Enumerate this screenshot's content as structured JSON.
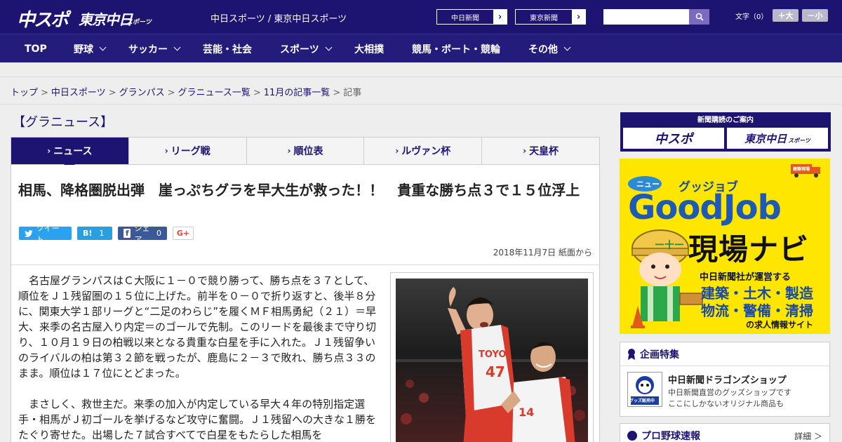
{
  "header": {
    "logo_chunichi": "中スポ",
    "logo_tokyo": "東京中日",
    "logo_tokyo_sub": "スポーツ",
    "site_links": "中日スポーツ / 東京中日スポーツ",
    "newspaper_btn_1": "中日新聞",
    "newspaper_btn_2": "東京新聞",
    "search_placeholder": "",
    "fontsize_label": "文字（0）",
    "fontsize_up": "＋大",
    "fontsize_down": "－小"
  },
  "nav": {
    "items": [
      {
        "label": "TOP"
      },
      {
        "label": "野球"
      },
      {
        "label": "サッカー"
      },
      {
        "label": "芸能・社会"
      },
      {
        "label": "スポーツ"
      },
      {
        "label": "大相撲"
      },
      {
        "label": "競馬・ボート・競輪"
      },
      {
        "label": "その他"
      }
    ]
  },
  "breadcrumb": {
    "items": [
      "トップ",
      "中日スポーツ",
      "グランパス",
      "グラニュース一覧",
      "11月の記事一覧"
    ],
    "current": "記事",
    "separator": ">"
  },
  "section_title": "【グラニュース】",
  "tabs": [
    {
      "label": "ニュース",
      "active": true
    },
    {
      "label": "リーグ戦"
    },
    {
      "label": "順位表"
    },
    {
      "label": "ルヴァン杯"
    },
    {
      "label": "天皇杯"
    }
  ],
  "article": {
    "headline": "相馬、降格圏脱出弾　崖っぷちグラを早大生が救った！！　貴重な勝ち点３で１５位浮上",
    "share": {
      "tweet": "ツイート",
      "hatena_label": "B!",
      "hatena_count": "1",
      "facebook": "シェア",
      "facebook_count": "0",
      "gplus": "G+"
    },
    "date": "2018年11月7日 紙面から",
    "paragraph_1": "名古屋グランパスはＣ大阪に１－０で競り勝って、勝ち点を３７として、順位をＪ１残留圏の１５位に上げた。前半を０－０で折り返すと、後半８分に、関東大学１部リーグと“二足のわらじ”を履くＭＦ相馬勇紀（２１）＝早大、来季の名古屋入り内定＝のゴールで先制。このリードを最後まで守り切り、１０月１９日の柏戦以来となる貴重な白星を手に入れた。Ｊ１残留争いのライバルの柏は第３２節を戦ったが、鹿島に２－３で敗れ、勝ち点３３のまま。順位は１７位にとどまった。",
    "paragraph_2": "まさしく、救世主だ。来季の加入が内定している早大４年の特別指定選手・相馬がＪ初ゴールを挙げるなど攻守に奮闘。Ｊ１残留への大きな１勝をたぐり寄せた。出場した７試合すべてで白星をもたらした相馬を"
  },
  "sidebar": {
    "subscribe_title": "新聞購読のご案内",
    "subscribe_logo_1": "中スポ",
    "subscribe_logo_2": "東京中日",
    "subscribe_logo_2_sub": "スポーツ",
    "ad": {
      "tag": "ニュー",
      "kana": "グッジョブ",
      "brand": "GoodJob",
      "title": "現場ナビ",
      "sub1": "中日新聞社が運営する",
      "sub2": "建築・土木・製造",
      "sub3": "物流・警備・清掃",
      "sub4": "の求人情報サイト",
      "truck_label": "建築現場"
    },
    "feature": {
      "head": "企画特集",
      "item_title": "中日新聞ドラゴンズショップ",
      "item_desc_1": "中日新聞直営のグッズショップです",
      "item_desc_2": "ここにしかないオリジナル商品も",
      "item_badge": "グッズ販売中"
    },
    "baseball": {
      "head": "プロ野球速報",
      "more": "詳細 ＞"
    }
  },
  "colors": {
    "brand_navy": "#1c1470",
    "nav_bg": "#241c7a",
    "ad_yellow": "#ffe600"
  }
}
